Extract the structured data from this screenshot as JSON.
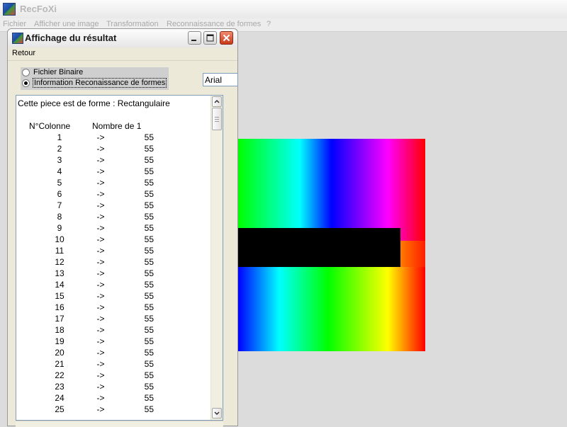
{
  "app": {
    "title": "RecFoXi",
    "menu": [
      "Fichier",
      "Afficher une image",
      "Transformation",
      "Reconnaissance de formes",
      "?"
    ]
  },
  "result_window": {
    "title": "Affichage du résultat",
    "menu": [
      "Retour"
    ],
    "radio_options": [
      {
        "label": "Fichier Binaire",
        "selected": false
      },
      {
        "label": "Information Reconaissance de formes",
        "selected": true
      }
    ],
    "font_value": "Arial",
    "shape_text": "Cette piece est de forme : Rectangulaire",
    "column_headers": [
      "N°Colonne",
      "Nombre de 1"
    ],
    "arrow": "->",
    "rows": [
      {
        "col": "1",
        "count": "55"
      },
      {
        "col": "2",
        "count": "55"
      },
      {
        "col": "3",
        "count": "55"
      },
      {
        "col": "4",
        "count": "55"
      },
      {
        "col": "5",
        "count": "55"
      },
      {
        "col": "6",
        "count": "55"
      },
      {
        "col": "7",
        "count": "55"
      },
      {
        "col": "8",
        "count": "55"
      },
      {
        "col": "9",
        "count": "55"
      },
      {
        "col": "10",
        "count": "55"
      },
      {
        "col": "11",
        "count": "55"
      },
      {
        "col": "12",
        "count": "55"
      },
      {
        "col": "13",
        "count": "55"
      },
      {
        "col": "14",
        "count": "55"
      },
      {
        "col": "15",
        "count": "55"
      },
      {
        "col": "16",
        "count": "55"
      },
      {
        "col": "17",
        "count": "55"
      },
      {
        "col": "18",
        "count": "55"
      },
      {
        "col": "19",
        "count": "55"
      },
      {
        "col": "20",
        "count": "55"
      },
      {
        "col": "21",
        "count": "55"
      },
      {
        "col": "22",
        "count": "55"
      },
      {
        "col": "23",
        "count": "55"
      },
      {
        "col": "24",
        "count": "55"
      },
      {
        "col": "25",
        "count": "55"
      }
    ]
  },
  "colors": {
    "title_active": "#1a1a1a",
    "title_inactive": "#b8b8b8",
    "close_button": "#d2492a",
    "desktop": "#dcdcdc"
  }
}
